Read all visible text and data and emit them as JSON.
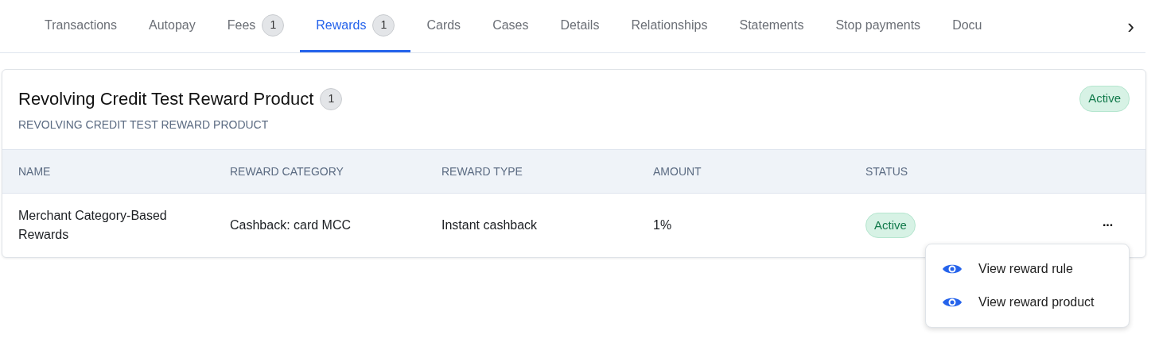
{
  "tabs": [
    {
      "label": "Transactions",
      "selected": false
    },
    {
      "label": "Autopay",
      "selected": false
    },
    {
      "label": "Fees",
      "count": "1",
      "selected": false
    },
    {
      "label": "Rewards",
      "count": "1",
      "selected": true
    },
    {
      "label": "Cards",
      "selected": false
    },
    {
      "label": "Cases",
      "selected": false
    },
    {
      "label": "Details",
      "selected": false
    },
    {
      "label": "Relationships",
      "selected": false
    },
    {
      "label": "Statements",
      "selected": false
    },
    {
      "label": "Stop payments",
      "selected": false
    },
    {
      "label": "Docu",
      "selected": false
    }
  ],
  "tabs_scroll": "›",
  "card": {
    "title": "Revolving Credit Test Reward Product",
    "count": "1",
    "subtitle": "REVOLVING CREDIT TEST REWARD PRODUCT",
    "status": "Active",
    "table": {
      "columns": [
        "NAME",
        "REWARD CATEGORY",
        "REWARD TYPE",
        "AMOUNT",
        "STATUS"
      ],
      "rows": [
        {
          "name": "Merchant Category-Based Rewards",
          "category": "Cashback: card MCC",
          "type": "Instant cashback",
          "amount": "1%",
          "status": "Active",
          "menu_button": "···"
        }
      ]
    }
  },
  "menu": {
    "items": [
      "View reward rule",
      "View reward product"
    ]
  }
}
